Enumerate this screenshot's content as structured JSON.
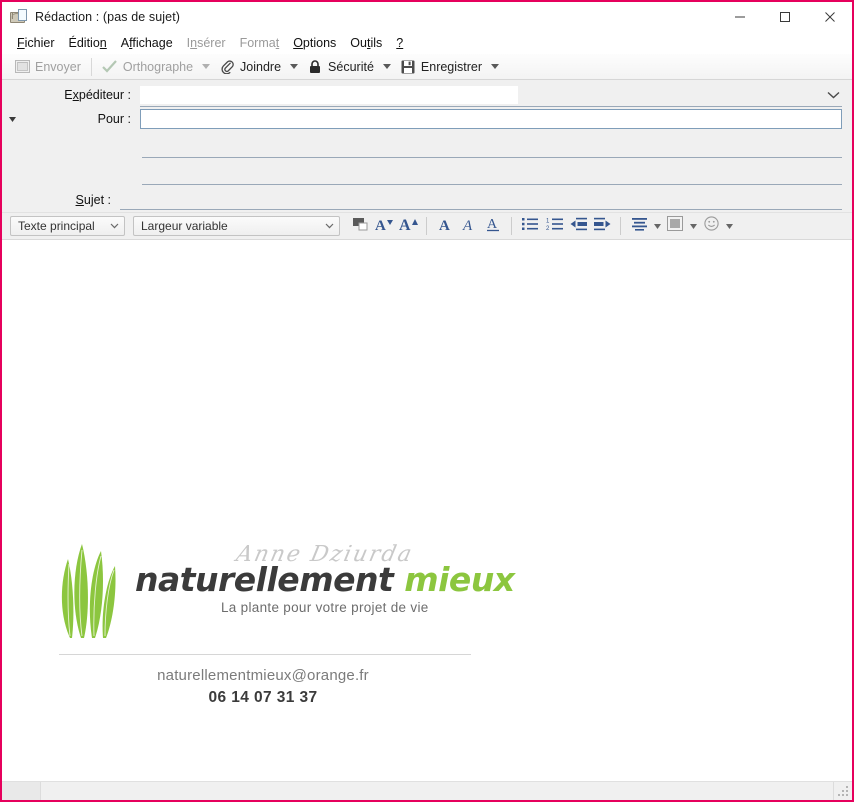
{
  "window": {
    "title": "Rédaction : (pas de sujet)",
    "icon": "compose-message-icon",
    "border_color": "#e6005c",
    "controls": {
      "minimize": "Réduire",
      "maximize": "Agrandir",
      "close": "Fermer"
    }
  },
  "menubar": {
    "items": [
      {
        "label": "Fichier",
        "accel": "F",
        "disabled": false
      },
      {
        "label": "Édition",
        "accel": "n",
        "disabled": false
      },
      {
        "label": "Affichage",
        "accel": "f",
        "disabled": false
      },
      {
        "label": "Insérer",
        "accel": "n",
        "disabled": true
      },
      {
        "label": "Format",
        "accel": "t",
        "disabled": true
      },
      {
        "label": "Options",
        "accel": "O",
        "disabled": false
      },
      {
        "label": "Outils",
        "accel": "t",
        "disabled": false
      },
      {
        "label": "?",
        "accel": "?",
        "disabled": false
      }
    ]
  },
  "toolbar": {
    "send_label": "Envoyer",
    "spell_label": "Orthographe",
    "attach_label": "Joindre",
    "security_label": "Sécurité",
    "save_label": "Enregistrer",
    "send_icon": "send-envelope-icon",
    "spell_icon": "spellcheck-check-icon",
    "attach_icon": "paperclip-icon",
    "security_icon": "padlock-icon",
    "save_icon": "floppy-disk-icon",
    "dropdown_icon": "chevron-down-icon"
  },
  "headers": {
    "from_label": "Expéditeur :",
    "from_value": "",
    "from_dropdown_icon": "chevron-down-icon",
    "to_label": "Pour :",
    "to_value": "",
    "to_expander_icon": "triangle-down-icon",
    "subject_label": "Sujet :",
    "subject_value": "",
    "empty_rows": 2
  },
  "format_toolbar": {
    "paragraph_style": "Texte principal",
    "font_family": "Largeur variable",
    "dropdown_icon": "chevron-down-icon",
    "buttons": [
      {
        "name": "text-color-icon",
        "label": "Couleur du texte"
      },
      {
        "name": "decrease-font-icon",
        "label": "Réduire la taille du texte"
      },
      {
        "name": "increase-font-icon",
        "label": "Augmenter la taille du texte"
      },
      {
        "name": "bold-icon",
        "label": "Gras"
      },
      {
        "name": "italic-icon",
        "label": "Italique"
      },
      {
        "name": "underline-icon",
        "label": "Souligné"
      },
      {
        "name": "bullet-list-icon",
        "label": "Liste à puces"
      },
      {
        "name": "numbered-list-icon",
        "label": "Liste numérotée"
      },
      {
        "name": "outdent-icon",
        "label": "Diminuer le retrait"
      },
      {
        "name": "indent-icon",
        "label": "Augmenter le retrait"
      },
      {
        "name": "align-icon",
        "label": "Alignement"
      },
      {
        "name": "insert-object-icon",
        "label": "Insérer"
      },
      {
        "name": "smiley-icon",
        "label": "Insérer une frimousse"
      }
    ]
  },
  "signature": {
    "logo_icon": "green-leaves-logo",
    "logo_color": "#8cc63f",
    "person_name": "Anne Dziurda",
    "brand_part1": "naturellement",
    "brand_part2": "mieux",
    "tagline": "La plante pour votre projet de vie",
    "email": "naturellementmieux@orange.fr",
    "phone": "06 14 07 31 37",
    "brand_dark_color": "#3b3b3b",
    "brand_accent_color": "#8cc63f"
  },
  "statusbar": {
    "scroll_icon": "horizontal-scrollbar",
    "resize_grip_icon": "resize-grip-icon"
  }
}
